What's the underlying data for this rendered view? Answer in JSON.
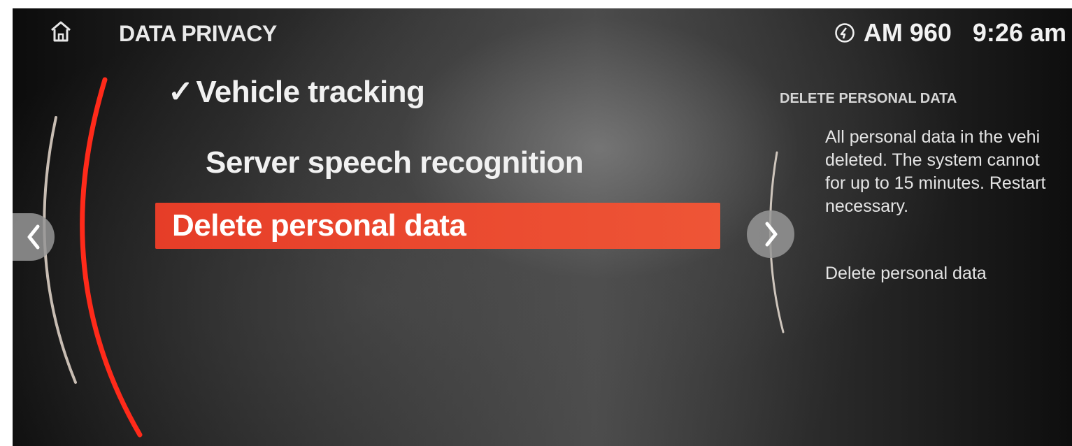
{
  "header": {
    "title": "DATA PRIVACY",
    "home_icon": "home-icon",
    "source_icon": "radio-source-icon",
    "radio_station": "AM 960",
    "clock": "9:26 am"
  },
  "menu": {
    "items": [
      {
        "label": "Vehicle tracking",
        "checked": true,
        "check_glyph": "✓"
      },
      {
        "label": "Server speech recognition",
        "checked": false
      },
      {
        "label": "Delete personal data",
        "selected": true
      }
    ]
  },
  "navigation": {
    "prev_icon": "chevron-left-icon",
    "next_icon": "chevron-right-icon"
  },
  "side_panel": {
    "heading": "DELETE PERSONAL DATA",
    "body_lines": [
      "All personal data in the vehi",
      "deleted. The system cannot",
      "for up to 15 minutes. Restart",
      "necessary."
    ],
    "action_label": "Delete personal data"
  },
  "colors": {
    "accent": "#e84a2f",
    "accent_arc": "#ff2a1a",
    "text": "#f1f1f1",
    "nav_button": "#969696"
  }
}
